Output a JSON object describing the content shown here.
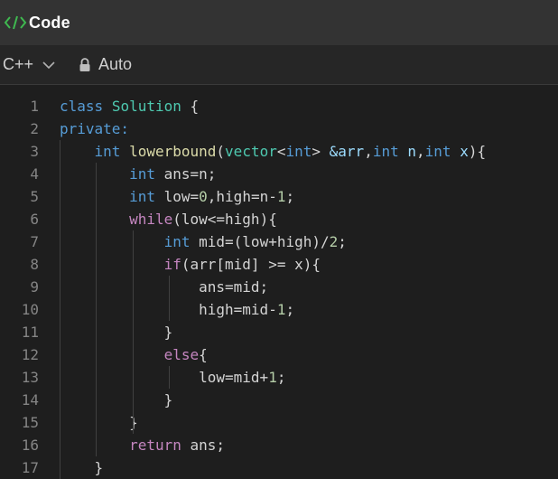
{
  "header": {
    "title": "Code",
    "icon": "code-brackets-icon",
    "accent": "#3fb950"
  },
  "toolbar": {
    "language": "C++",
    "mode": "Auto",
    "lock_icon": "lock-icon"
  },
  "editor": {
    "line_numbers": [
      "1",
      "2",
      "3",
      "4",
      "5",
      "6",
      "7",
      "8",
      "9",
      "10",
      "11",
      "12",
      "13",
      "14",
      "15",
      "16",
      "17"
    ],
    "lines": [
      [
        [
          "kw",
          "class"
        ],
        [
          "pl",
          " "
        ],
        [
          "cls",
          "Solution"
        ],
        [
          "pl",
          " {"
        ]
      ],
      [
        [
          "kw",
          "private:"
        ]
      ],
      [
        [
          "pl",
          "    "
        ],
        [
          "ty",
          "int"
        ],
        [
          "pl",
          " "
        ],
        [
          "fn",
          "lowerbound"
        ],
        [
          "pl",
          "("
        ],
        [
          "cls",
          "vector"
        ],
        [
          "pl",
          "<"
        ],
        [
          "ty",
          "int"
        ],
        [
          "pl",
          "> "
        ],
        [
          "var",
          "&arr"
        ],
        [
          "pl",
          ","
        ],
        [
          "ty",
          "int"
        ],
        [
          "pl",
          " "
        ],
        [
          "var",
          "n"
        ],
        [
          "pl",
          ","
        ],
        [
          "ty",
          "int"
        ],
        [
          "pl",
          " "
        ],
        [
          "var",
          "x"
        ],
        [
          "pl",
          "){"
        ]
      ],
      [
        [
          "pl",
          "        "
        ],
        [
          "ty",
          "int"
        ],
        [
          "pl",
          " ans=n;"
        ]
      ],
      [
        [
          "pl",
          "        "
        ],
        [
          "ty",
          "int"
        ],
        [
          "pl",
          " low="
        ],
        [
          "num",
          "0"
        ],
        [
          "pl",
          ",high=n-"
        ],
        [
          "num",
          "1"
        ],
        [
          "pl",
          ";"
        ]
      ],
      [
        [
          "pl",
          "        "
        ],
        [
          "ctl",
          "while"
        ],
        [
          "pl",
          "(low<=high){"
        ]
      ],
      [
        [
          "pl",
          "            "
        ],
        [
          "ty",
          "int"
        ],
        [
          "pl",
          " mid=(low+high)/"
        ],
        [
          "num",
          "2"
        ],
        [
          "pl",
          ";"
        ]
      ],
      [
        [
          "pl",
          "            "
        ],
        [
          "ctl",
          "if"
        ],
        [
          "pl",
          "(arr[mid] >= x){"
        ]
      ],
      [
        [
          "pl",
          "                ans=mid;"
        ]
      ],
      [
        [
          "pl",
          "                high=mid-"
        ],
        [
          "num",
          "1"
        ],
        [
          "pl",
          ";"
        ]
      ],
      [
        [
          "pl",
          "            }"
        ]
      ],
      [
        [
          "pl",
          "            "
        ],
        [
          "ctl",
          "else"
        ],
        [
          "pl",
          "{"
        ]
      ],
      [
        [
          "pl",
          "                low=mid+"
        ],
        [
          "num",
          "1"
        ],
        [
          "pl",
          ";"
        ]
      ],
      [
        [
          "pl",
          "            }"
        ]
      ],
      [
        [
          "pl",
          "        }"
        ]
      ],
      [
        [
          "pl",
          "        "
        ],
        [
          "ctl",
          "return"
        ],
        [
          "pl",
          " ans;"
        ]
      ],
      [
        [
          "pl",
          "    }"
        ]
      ]
    ]
  }
}
